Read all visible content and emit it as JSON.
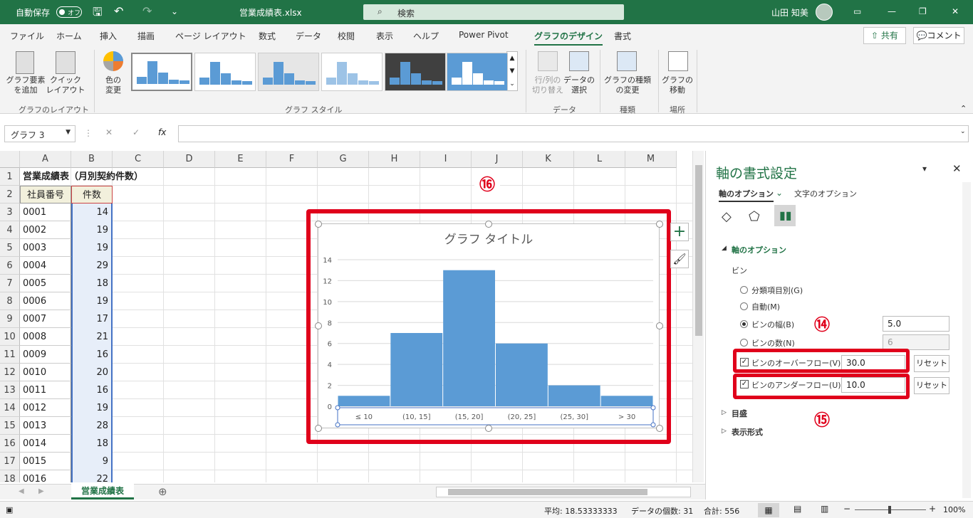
{
  "titlebar": {
    "autosave": "自動保存",
    "toggle": "オフ",
    "filename": "営業成績表.xlsx",
    "search": "検索",
    "user": "山田 知美"
  },
  "ribbon_tabs": [
    "ファイル",
    "ホーム",
    "挿入",
    "描画",
    "ページ レイアウト",
    "数式",
    "データ",
    "校閲",
    "表示",
    "ヘルプ",
    "Power Pivot",
    "グラフのデザイン",
    "書式"
  ],
  "active_tab": "グラフのデザイン",
  "share": {
    "share": "共有",
    "comment": "コメント"
  },
  "ribbon": {
    "add_element": "グラフ要素\nを追加",
    "quick_layout": "クイック\nレイアウト",
    "layout_group": "グラフのレイアウト",
    "colors": "色の\n変更",
    "style_group": "グラフ スタイル",
    "switch_rowcol": "行/列の\n切り替え",
    "select_data": "データの\n選択",
    "data_group": "データ",
    "change_type": "グラフの種類\nの変更",
    "type_group": "種類",
    "move_chart": "グラフの\n移動",
    "location_group": "場所"
  },
  "formula_bar": {
    "name_box": "グラフ 3",
    "fx": "fx",
    "formula": ""
  },
  "columns": [
    "A",
    "B",
    "C",
    "D",
    "E",
    "F",
    "G",
    "H",
    "I",
    "J",
    "K",
    "L",
    "M"
  ],
  "rows": [
    {
      "n": "1",
      "a": "営業成績表（月別契約件数）",
      "b": ""
    },
    {
      "n": "2",
      "a": "社員番号",
      "b": "件数"
    },
    {
      "n": "3",
      "a": "0001",
      "b": "14"
    },
    {
      "n": "4",
      "a": "0002",
      "b": "19"
    },
    {
      "n": "5",
      "a": "0003",
      "b": "19"
    },
    {
      "n": "6",
      "a": "0004",
      "b": "29"
    },
    {
      "n": "7",
      "a": "0005",
      "b": "18"
    },
    {
      "n": "8",
      "a": "0006",
      "b": "19"
    },
    {
      "n": "9",
      "a": "0007",
      "b": "17"
    },
    {
      "n": "10",
      "a": "0008",
      "b": "21"
    },
    {
      "n": "11",
      "a": "0009",
      "b": "16"
    },
    {
      "n": "12",
      "a": "0010",
      "b": "20"
    },
    {
      "n": "13",
      "a": "0011",
      "b": "16"
    },
    {
      "n": "14",
      "a": "0012",
      "b": "19"
    },
    {
      "n": "15",
      "a": "0013",
      "b": "28"
    },
    {
      "n": "16",
      "a": "0014",
      "b": "18"
    },
    {
      "n": "17",
      "a": "0015",
      "b": "9"
    },
    {
      "n": "18",
      "a": "0016",
      "b": "22"
    }
  ],
  "chart_data": {
    "type": "bar",
    "title": "グラフ タイトル",
    "categories": [
      "≤ 10",
      "(10, 15]",
      "(15, 20]",
      "(20, 25]",
      "(25, 30]",
      "> 30"
    ],
    "values": [
      1,
      7,
      13,
      6,
      2,
      1
    ],
    "ylim": [
      0,
      14
    ],
    "yticks": [
      0,
      2,
      4,
      6,
      8,
      10,
      12,
      14
    ],
    "bar_color": "#5b9bd5",
    "grid": true
  },
  "pane": {
    "title": "軸の書式設定",
    "tab_axis": "軸のオプション",
    "tab_text": "文字のオプション",
    "section": "軸のオプション",
    "bin": "ビン",
    "opt_category": "分類項目別(G)",
    "opt_auto": "自動(M)",
    "opt_width": "ビンの幅(B)",
    "opt_count": "ビンの数(N)",
    "width_value": "5.0",
    "count_value": "6",
    "overflow_label": "ビンのオーバーフロー(V)",
    "overflow_value": "30.0",
    "underflow_label": "ビンのアンダーフロー(U)",
    "underflow_value": "10.0",
    "reset": "リセット",
    "ticks": "目盛",
    "format": "表示形式"
  },
  "callouts": {
    "c14": "⑭",
    "c15": "⑮",
    "c16": "⑯"
  },
  "sheet_tab": "営業成績表",
  "status": {
    "average": "平均: 18.53333333",
    "count": "データの個数: 31",
    "sum": "合計: 556",
    "zoom": "100%"
  },
  "accent": "#217346",
  "highlight": "#e0001b"
}
